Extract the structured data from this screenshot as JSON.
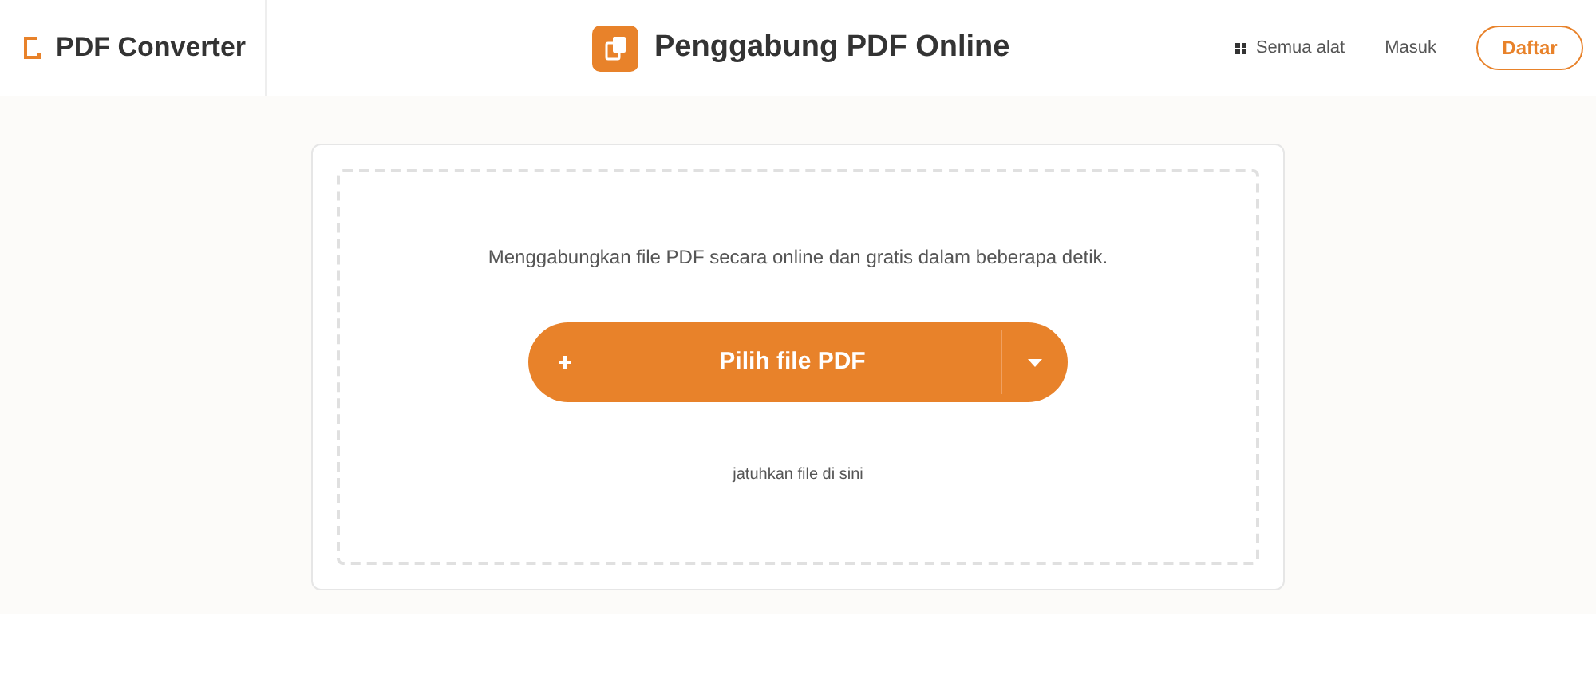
{
  "brand": {
    "name": "PDF Converter"
  },
  "header": {
    "title": "Penggabung PDF Online",
    "nav": [
      "Semua alat",
      "Masuk"
    ],
    "signup": "Daftar"
  },
  "upload": {
    "description": "Menggabungkan file PDF secara online dan gratis dalam beberapa detik.",
    "button": "Pilih file PDF",
    "drop_hint": "jatuhkan file di sini"
  }
}
